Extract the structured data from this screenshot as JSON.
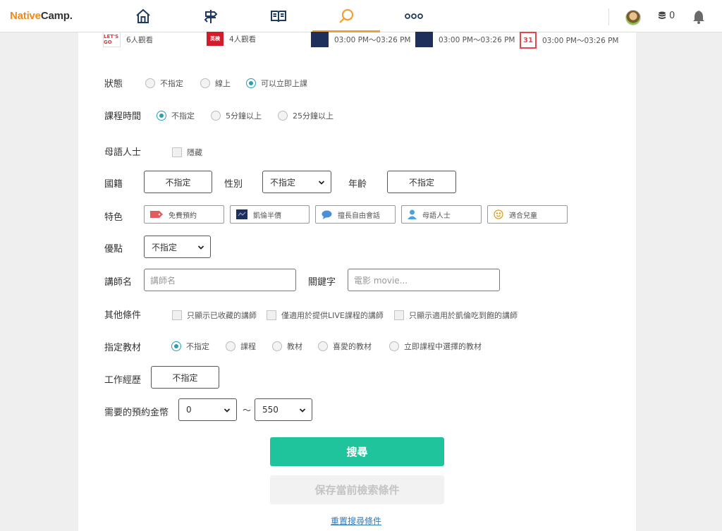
{
  "header": {
    "logo_native": "Native",
    "logo_camp": "Camp.",
    "coin_count": "0",
    "accent_color": "#f0a033"
  },
  "lesson_strip": [
    {
      "thumb": "LET'S GO",
      "text": "6人觀看",
      "thumb_color": "#e33"
    },
    {
      "thumb": "英検",
      "text": "4人觀看",
      "thumb_color": "#d31c2a"
    },
    {
      "thumb": "",
      "text": "03:00 PM～03:26 PM",
      "thumb_color": "#1d2f5a"
    },
    {
      "thumb": "",
      "text": "03:00 PM～03:26 PM",
      "thumb_color": "#1d2f5a"
    },
    {
      "thumb": "31",
      "text": "03:00 PM～03:26 PM",
      "thumb_color": "#e5454d"
    }
  ],
  "status": {
    "label": "狀態",
    "options": [
      "不指定",
      "線上",
      "可以立即上課"
    ]
  },
  "duration": {
    "label": "課程時間",
    "options": [
      "不指定",
      "5分鐘以上",
      "25分鐘以上"
    ]
  },
  "native": {
    "label": "母語人士",
    "checkbox": "隱藏"
  },
  "nationality": {
    "label": "國籍",
    "value": "不指定"
  },
  "gender": {
    "label": "性別",
    "value": "不指定"
  },
  "age": {
    "label": "年齡",
    "value": "不指定"
  },
  "features": {
    "label": "特色",
    "items": [
      "免費預約",
      "凱倫半價",
      "擅長自由會話",
      "母語人士",
      "適合兒童"
    ]
  },
  "merit": {
    "label": "優點",
    "value": "不指定"
  },
  "teacher_name": {
    "label": "講師名",
    "placeholder": "講師名"
  },
  "keyword": {
    "label": "關鍵字",
    "placeholder": "電影 movie..."
  },
  "other": {
    "label": "其他條件",
    "options": [
      "只顯示已收藏的講師",
      "僅適用於提供LIVE課程的講師",
      "只顯示適用於凱倫吃到飽的講師"
    ]
  },
  "material": {
    "label": "指定教材",
    "options": [
      "不指定",
      "課程",
      "教材",
      "喜愛的教材",
      "立即課程中選擇的教材"
    ]
  },
  "work": {
    "label": "工作經歷",
    "value": "不指定"
  },
  "price": {
    "label": "需要的預約金幣",
    "min": "0",
    "sep": "～",
    "max": "550"
  },
  "actions": {
    "search": "搜尋",
    "save": "保存當前檢索條件",
    "reset": "重置搜尋條件",
    "search_color": "#1fc49c"
  }
}
